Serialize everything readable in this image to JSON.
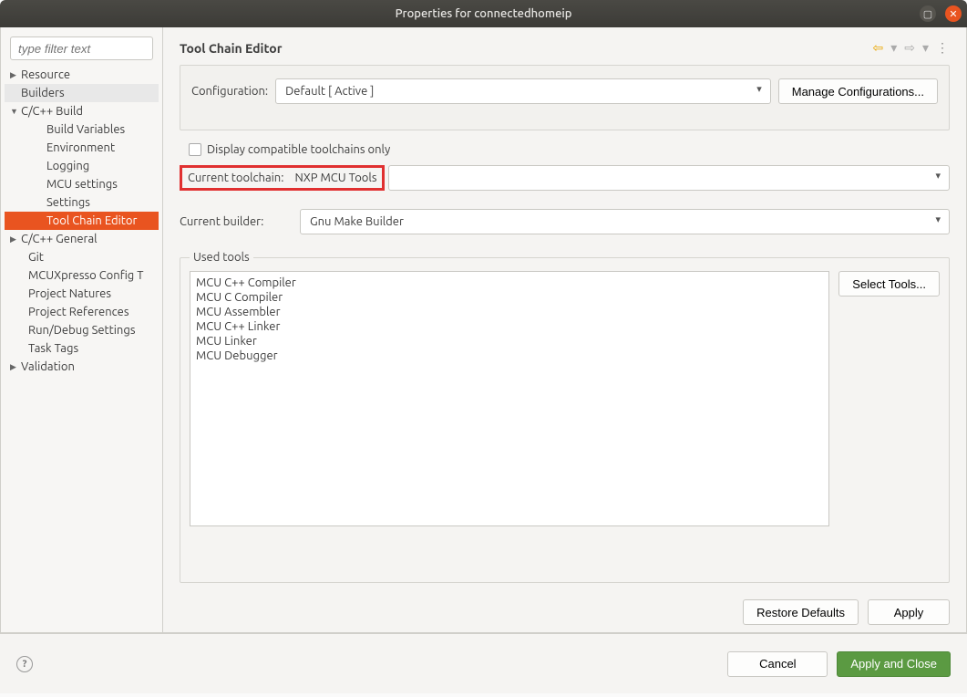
{
  "window": {
    "title": "Properties for connectedhomeip"
  },
  "filter": {
    "placeholder": "type filter text"
  },
  "tree": {
    "resource": "Resource",
    "builders": "Builders",
    "ccbuild": "C/C++ Build",
    "build_variables": "Build Variables",
    "environment": "Environment",
    "logging": "Logging",
    "mcu_settings": "MCU settings",
    "settings": "Settings",
    "toolchain_editor": "Tool Chain Editor",
    "ccgeneral": "C/C++ General",
    "git": "Git",
    "mcuxpresso": "MCUXpresso Config T",
    "project_natures": "Project Natures",
    "project_references": "Project References",
    "run_debug": "Run/Debug Settings",
    "task_tags": "Task Tags",
    "validation": "Validation"
  },
  "page": {
    "title": "Tool Chain Editor"
  },
  "config": {
    "label": "Configuration:",
    "value": "Default  [ Active ]",
    "manage": "Manage Configurations..."
  },
  "display_compat": {
    "label": "Display compatible toolchains only"
  },
  "toolchain": {
    "label": "Current toolchain:",
    "value": "NXP MCU Tools"
  },
  "builder": {
    "label": "Current builder:",
    "value": "Gnu Make Builder"
  },
  "used_tools": {
    "legend": "Used tools",
    "items": [
      "MCU C++ Compiler",
      "MCU C Compiler",
      "MCU Assembler",
      "MCU C++ Linker",
      "MCU Linker",
      "MCU Debugger"
    ],
    "select": "Select Tools..."
  },
  "footer": {
    "restore": "Restore Defaults",
    "apply": "Apply",
    "cancel": "Cancel",
    "apply_close": "Apply and Close"
  }
}
